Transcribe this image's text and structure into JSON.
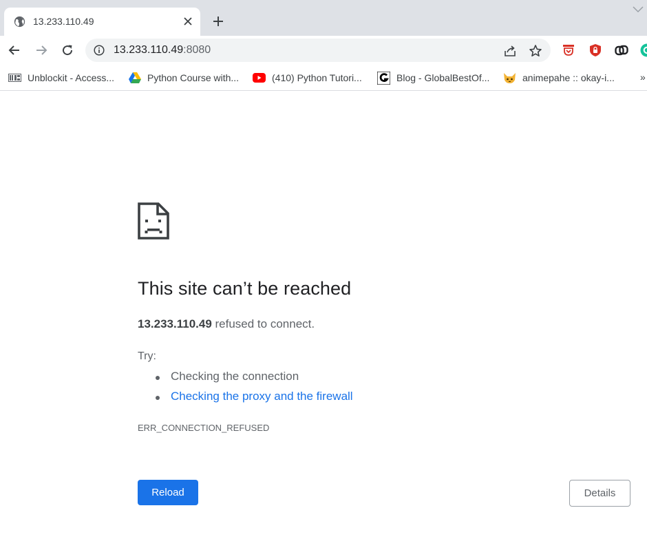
{
  "tab": {
    "title": "13.233.110.49",
    "favicon": "globe-icon"
  },
  "toolbar": {
    "url_host": "13.233.110.49",
    "url_port": ":8080"
  },
  "bookmarks": [
    {
      "label": "Unblockit - Access...",
      "icon": "unblockit-icon"
    },
    {
      "label": "Python Course with...",
      "icon": "google-drive-icon"
    },
    {
      "label": "(410) Python Tutori...",
      "icon": "youtube-icon"
    },
    {
      "label": "Blog - GlobalBestOf...",
      "icon": "g-blog-icon"
    },
    {
      "label": "animepahe :: okay-i...",
      "icon": "animepahe-icon"
    }
  ],
  "bookmarks_more": "»",
  "error": {
    "headline": "This site can’t be reached",
    "host": "13.233.110.49",
    "message": " refused to connect.",
    "try_label": "Try:",
    "suggestions": [
      {
        "text": "Checking the connection",
        "link": false
      },
      {
        "text": "Checking the proxy and the firewall",
        "link": true
      }
    ],
    "code": "ERR_CONNECTION_REFUSED",
    "reload_label": "Reload",
    "details_label": "Details"
  },
  "colors": {
    "accent": "#1a73e8",
    "tabstrip": "#dee1e6",
    "omnibox": "#f1f3f4",
    "text_secondary": "#5f6368"
  }
}
